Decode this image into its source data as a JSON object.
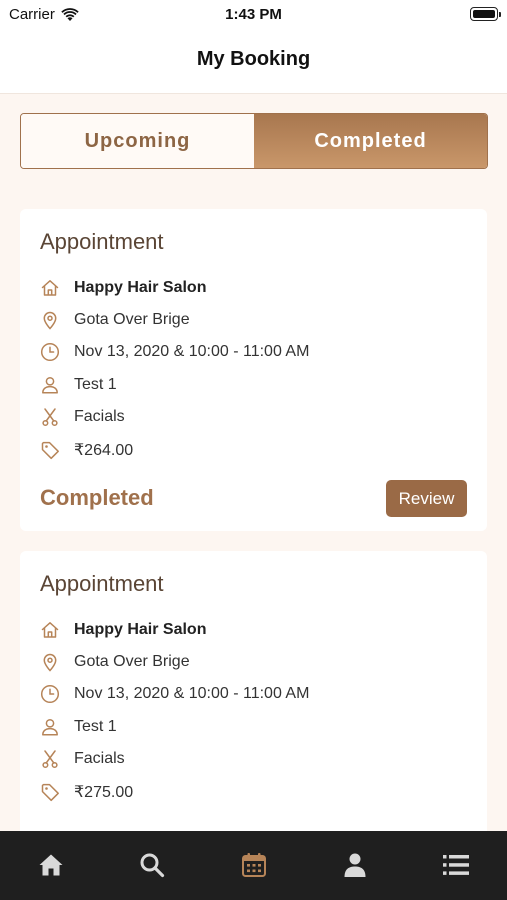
{
  "status_bar": {
    "carrier": "Carrier",
    "time": "1:43 PM"
  },
  "header": {
    "title": "My Booking"
  },
  "tabs": [
    {
      "label": "Upcoming",
      "active": false
    },
    {
      "label": "Completed",
      "active": true
    }
  ],
  "bookings": [
    {
      "title": "Appointment",
      "salon": "Happy Hair Salon",
      "address": "Gota Over Brige",
      "datetime": "Nov 13, 2020 & 10:00 - 11:00 AM",
      "customer": "Test 1",
      "service": "Facials",
      "price": "₹264.00",
      "status": "Completed",
      "action_label": "Review"
    },
    {
      "title": "Appointment",
      "salon": "Happy Hair Salon",
      "address": "Gota Over Brige",
      "datetime": "Nov 13, 2020 & 10:00 - 11:00 AM",
      "customer": "Test 1",
      "service": "Facials",
      "price": "₹275.00"
    }
  ],
  "bottom_nav": [
    {
      "icon": "home-icon",
      "active": false
    },
    {
      "icon": "search-icon",
      "active": false
    },
    {
      "icon": "calendar-icon",
      "active": true
    },
    {
      "icon": "profile-icon",
      "active": false
    },
    {
      "icon": "menu-list-icon",
      "active": false
    }
  ],
  "colors": {
    "accent": "#a0714c",
    "accent_dark": "#9a6a46",
    "background": "#fdf6f1",
    "tab_bar": "#1f1f1f",
    "active_tab_icon": "#b68458",
    "inactive_tab_icon": "#d9d9d9"
  }
}
